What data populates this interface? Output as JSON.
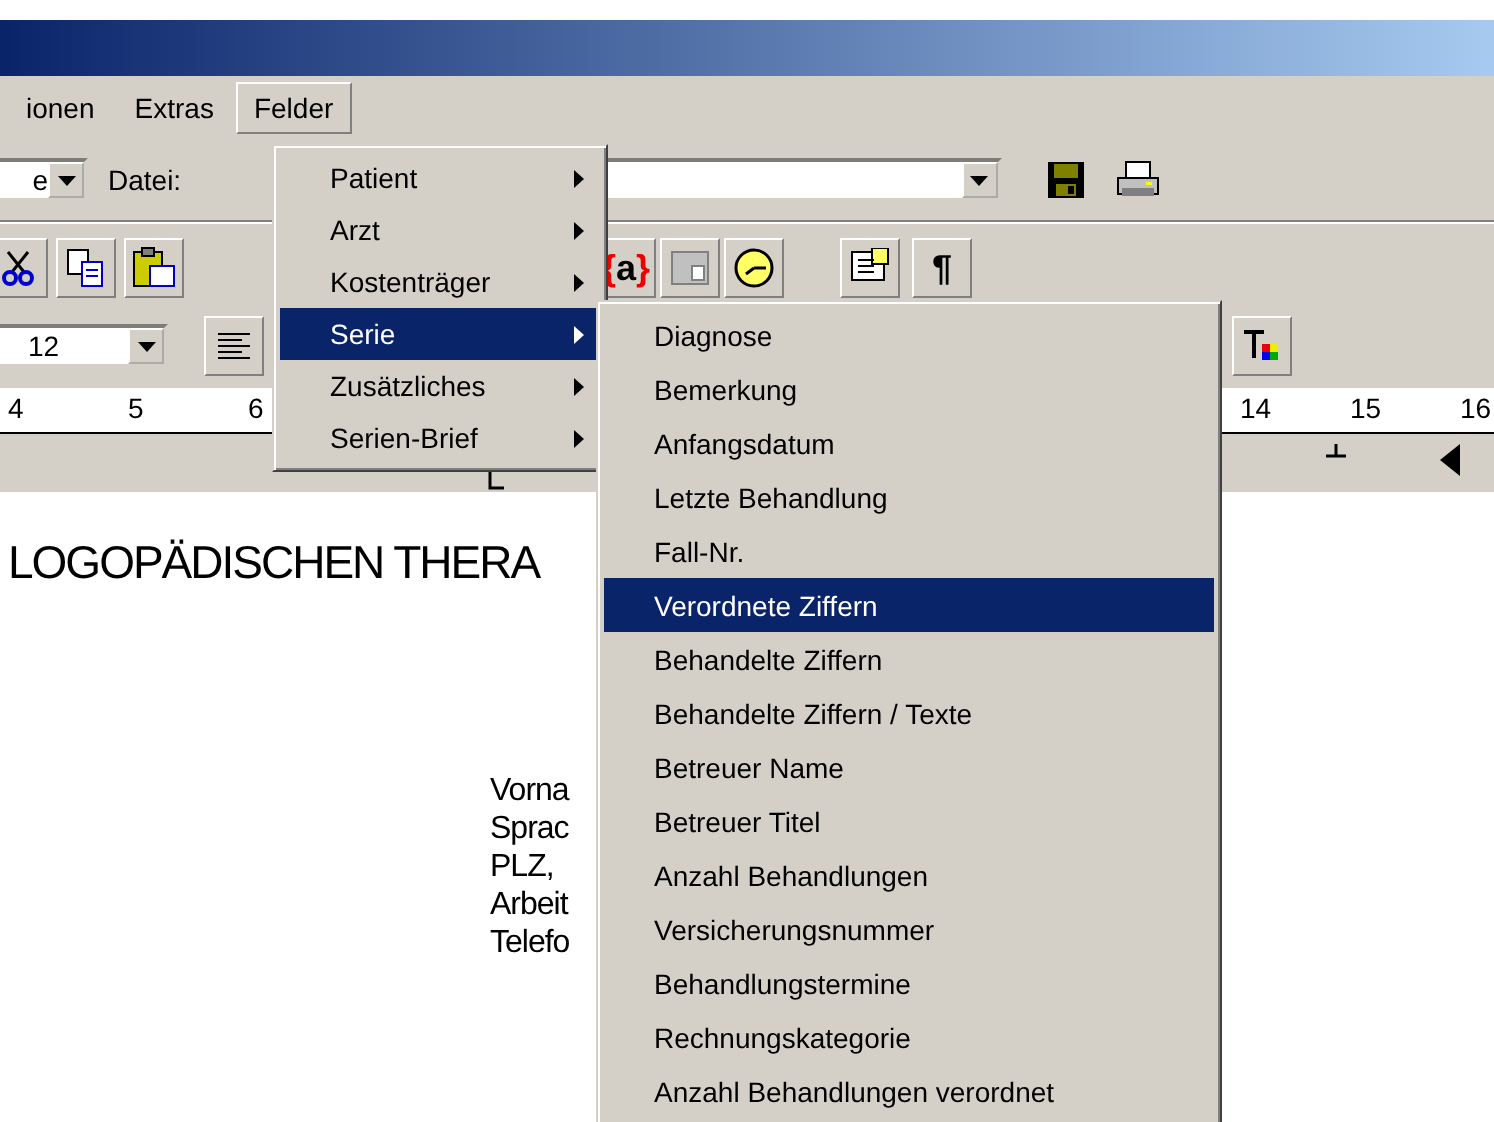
{
  "menubar": [
    {
      "label": "ionen",
      "selected": false
    },
    {
      "label": "Extras",
      "selected": false
    },
    {
      "label": "Felder",
      "selected": true
    }
  ],
  "toolbar": {
    "view_combo": "e",
    "file_label": "Datei:"
  },
  "insert_bar": {
    "field_button": "{a}",
    "pilcrow_button": "¶"
  },
  "format_bar": {
    "font_size": "12"
  },
  "ruler": {
    "left_marks": [
      "4",
      "5",
      "6"
    ],
    "right_marks": [
      "14",
      "15",
      "16"
    ]
  },
  "document": {
    "heading": "LOGOPÄDISCHEN THERA",
    "lines": [
      "Vorna",
      "Sprac",
      "PLZ,",
      "Arbeit",
      "Telefo"
    ]
  },
  "felder_menu": [
    {
      "label": "Patient",
      "selected": false
    },
    {
      "label": "Arzt",
      "selected": false
    },
    {
      "label": "Kostenträger",
      "selected": false
    },
    {
      "label": "Serie",
      "selected": true
    },
    {
      "label": "Zusätzliches",
      "selected": false
    },
    {
      "label": "Serien-Brief",
      "selected": false
    }
  ],
  "serie_submenu": [
    {
      "label": "Diagnose",
      "selected": false
    },
    {
      "label": "Bemerkung",
      "selected": false
    },
    {
      "label": "Anfangsdatum",
      "selected": false
    },
    {
      "label": "Letzte Behandlung",
      "selected": false
    },
    {
      "label": "Fall-Nr.",
      "selected": false
    },
    {
      "label": "Verordnete Ziffern",
      "selected": true
    },
    {
      "label": "Behandelte Ziffern",
      "selected": false
    },
    {
      "label": "Behandelte Ziffern / Texte",
      "selected": false
    },
    {
      "label": "Betreuer Name",
      "selected": false
    },
    {
      "label": "Betreuer Titel",
      "selected": false
    },
    {
      "label": "Anzahl Behandlungen",
      "selected": false
    },
    {
      "label": "Versicherungsnummer",
      "selected": false
    },
    {
      "label": "Behandlungstermine",
      "selected": false
    },
    {
      "label": "Rechnungskategorie",
      "selected": false
    },
    {
      "label": "Anzahl Behandlungen verordnet",
      "selected": false
    }
  ]
}
